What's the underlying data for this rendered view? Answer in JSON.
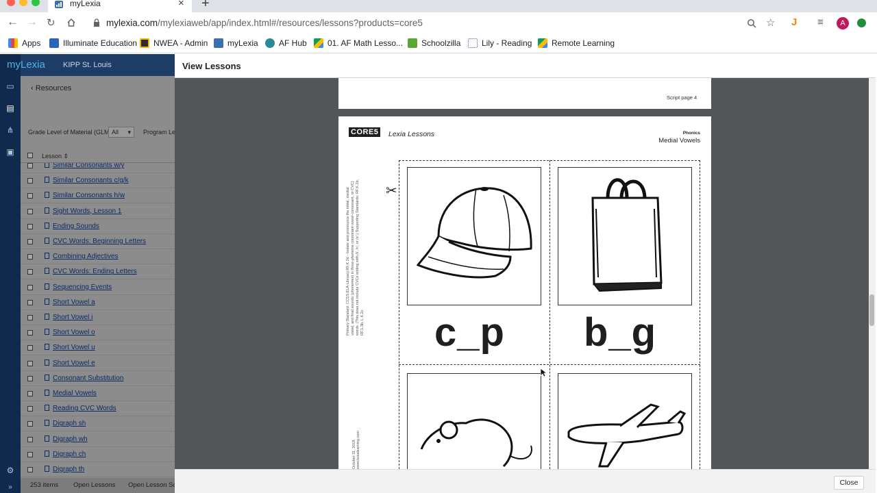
{
  "browser": {
    "tab_title": "myLexia",
    "new_tab": "+",
    "url_host": "mylexia.com",
    "url_path": "/mylexiaweb/app/index.html#/resources/lessons?products=core5",
    "avatar_letter": "A"
  },
  "bookmarks": [
    "Apps",
    "Illuminate Education",
    "NWEA - Admin",
    "myLexia",
    "AF Hub",
    "01. AF Math Lesso...",
    "Schoolzilla",
    "Lily - Reading",
    "Remote Learning"
  ],
  "app": {
    "logo": "myLexia",
    "school": "KIPP St. Louis",
    "back_link": "Resources",
    "filter_label": "Grade Level of Material (GLM)",
    "filter_value": "All",
    "program_level_label": "Program Lev",
    "lesson_column": "Lesson",
    "lessons": [
      "Similar Consonants w/y",
      "Similar Consonants c/g/k",
      "Similar Consonants h/w",
      "Sight Words, Lesson 1",
      "Ending Sounds",
      "CVC Words: Beginning Letters",
      "Combining Adjectives",
      "CVC Words: Ending Letters",
      "Sequencing Events",
      "Short Vowel a",
      "Short Vowel i",
      "Short Vowel o",
      "Short Vowel u",
      "Short Vowel e",
      "Consonant Substitution",
      "Medial Vowels",
      "Reading CVC Words",
      "Digraph sh",
      "Digraph wh",
      "Digraph ch",
      "Digraph th"
    ],
    "item_count": "253 items",
    "open_lessons": "Open Lessons",
    "open_lesson_scripts": "Open Lesson Sc"
  },
  "modal": {
    "title": "View Lessons",
    "close": "Close",
    "script_page": "Script page 4",
    "core5": "CORE5",
    "lexia_lessons": "Lexia Lessons",
    "category": "Phonics",
    "lesson_name": "Medial Vowels",
    "standards_text": "Primary Standard: CCSS.ELA-Literacy.RF.K.2d - Isolate and pronounce the initial, medial vowel, and final sounds (phonemes) in three-phoneme consonant-vowel-consonant, or CVC) words. (This does not include CVCs ending with /l/, /r/, or /x/.) Supporting Standards: RF.K.1b, RF.1.3b, L.K.2c",
    "footer_note": "October 31, 2018. www.lexialearning.com",
    "word1": "c_p",
    "word2": "b_g"
  },
  "colors": {
    "rail": "#0f2a4d",
    "header": "#1e3d66",
    "viewer_bg": "#525659"
  }
}
